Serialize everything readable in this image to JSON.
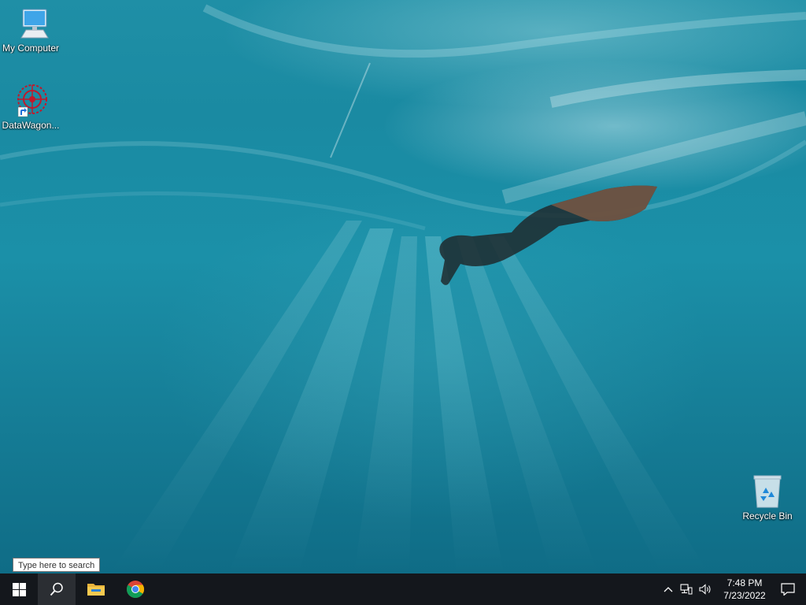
{
  "desktop": {
    "icons": [
      {
        "label": "My Computer",
        "icon": "computer-icon"
      },
      {
        "label": "DataWagon...",
        "icon": "datawagon-icon"
      },
      {
        "label": "Recycle Bin",
        "icon": "recycle-bin-icon"
      }
    ]
  },
  "taskbar": {
    "search_tooltip": "Type here to search",
    "start_icon": "windows-logo-icon",
    "search_icon": "search-icon",
    "pinned": [
      {
        "icon": "file-explorer-icon"
      },
      {
        "icon": "chrome-icon"
      }
    ],
    "tray": {
      "chevron_icon": "chevron-up-icon",
      "network_icon": "network-icon",
      "volume_icon": "speaker-icon",
      "time": "7:48 PM",
      "date": "7/23/2022",
      "notifications_icon": "notification-icon"
    }
  },
  "colors": {
    "taskbar": "#14171c",
    "water_top": "#1f8fa6",
    "water_bottom": "#0f6c86"
  }
}
